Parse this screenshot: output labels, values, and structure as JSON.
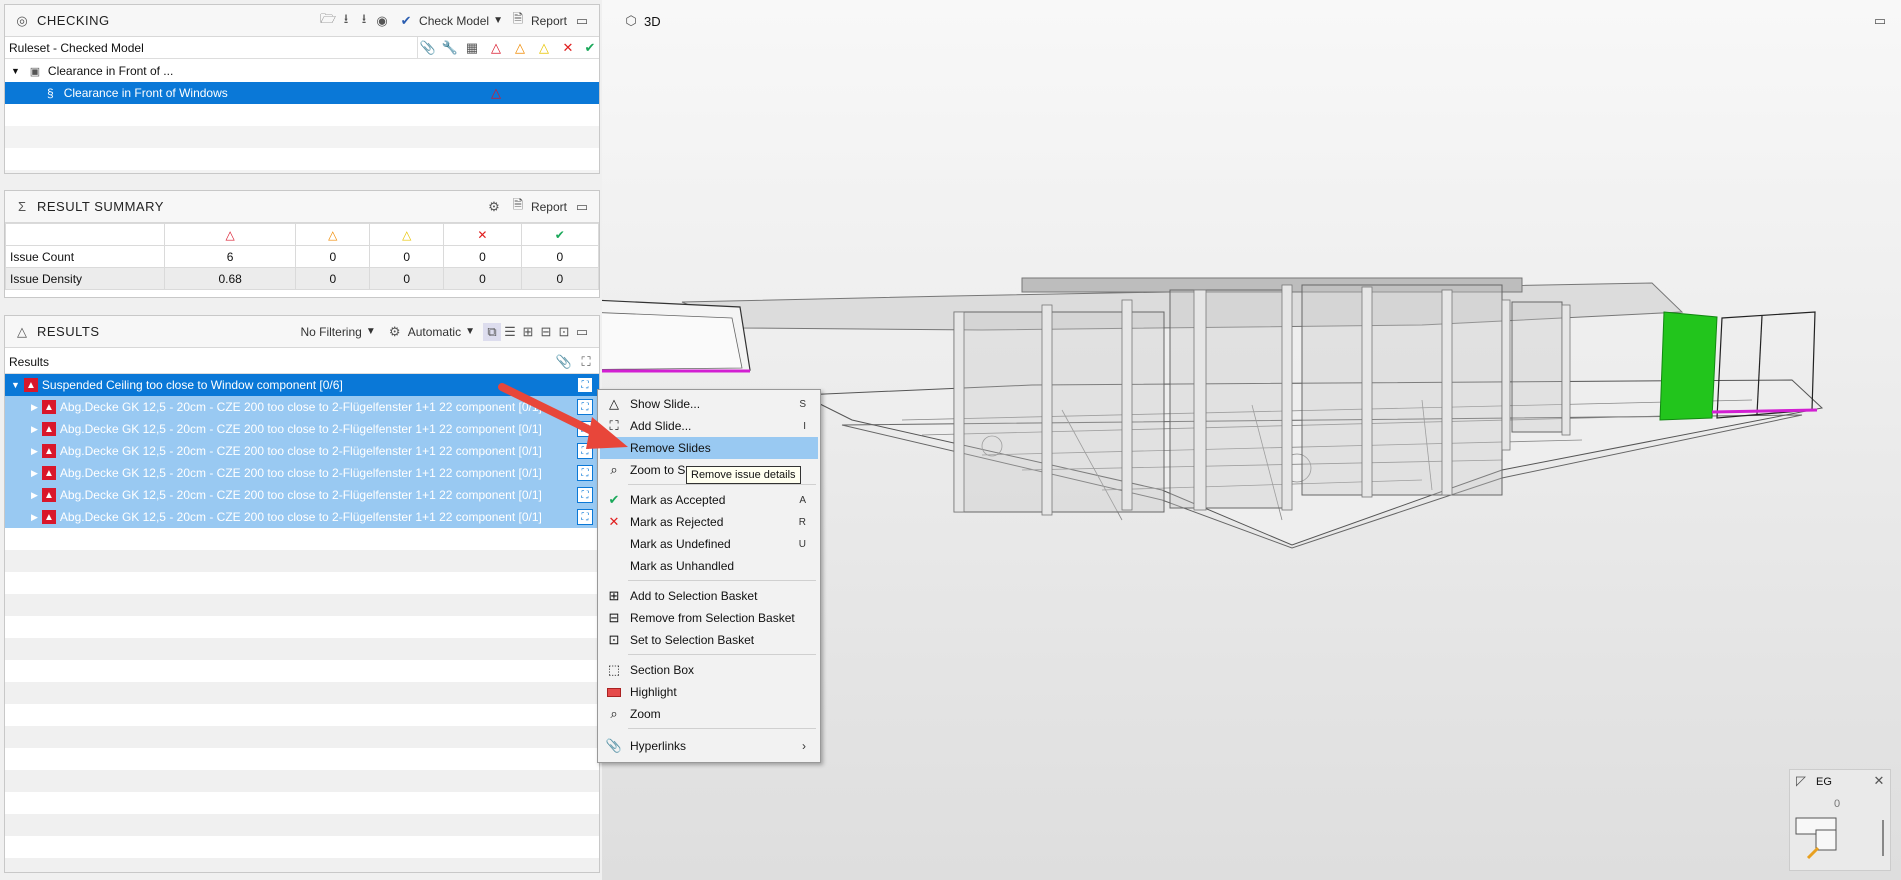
{
  "checking": {
    "title": "CHECKING",
    "check_model_label": "Check Model",
    "report_label": "Report",
    "ruleset_label": "Ruleset - Checked Model",
    "group_label": "Clearance in Front of ...",
    "rule_label": "Clearance in Front of Windows"
  },
  "summary": {
    "title": "RESULT SUMMARY",
    "report_label": "Report",
    "rows": [
      {
        "label": "Issue Count",
        "values": [
          "6",
          "0",
          "0",
          "0",
          "0"
        ]
      },
      {
        "label": "Issue Density",
        "values": [
          "0.68",
          "0",
          "0",
          "0",
          "0"
        ]
      }
    ]
  },
  "results": {
    "title": "RESULTS",
    "filter_label": "No Filtering",
    "auto_label": "Automatic",
    "column_header": "Results",
    "parent_label": "Suspended Ceiling too close to Window component [0/6]",
    "child_label": "Abg.Decke GK 12,5 - 20cm - CZE 200 too close to 2-Flügelfenster 1+1 22 component [0/1]",
    "child_count": 6
  },
  "menu": {
    "show_slide": "Show Slide...",
    "show_slide_key": "S",
    "add_slide": "Add Slide...",
    "add_slide_key": "I",
    "remove_slides": "Remove Slides",
    "zoom_to": "Zoom to S",
    "mark_accepted": "Mark as Accepted",
    "mark_accepted_key": "A",
    "mark_rejected": "Mark as Rejected",
    "mark_rejected_key": "R",
    "mark_undefined": "Mark as Undefined",
    "mark_undefined_key": "U",
    "mark_unhandled": "Mark as Unhandled",
    "add_basket": "Add to Selection Basket",
    "remove_basket": "Remove from Selection Basket",
    "set_basket": "Set to Selection Basket",
    "section_box": "Section Box",
    "highlight": "Highlight",
    "zoom": "Zoom",
    "hyperlinks": "Hyperlinks"
  },
  "tooltip": "Remove issue details",
  "viewport": {
    "tab_label": "3D",
    "minimap_label": "EG",
    "minimap_value": "0"
  },
  "colors": {
    "selection": "#0a78d7",
    "selection_light": "#99c9f2",
    "critical": "#d9172b",
    "major": "#f08a00",
    "minor": "#e8c400",
    "rejected": "#e01e1e",
    "accepted": "#1aa85a",
    "green_highlight": "#22c51c",
    "magenta": "#d21fd2",
    "arrow": "#e8463a"
  }
}
